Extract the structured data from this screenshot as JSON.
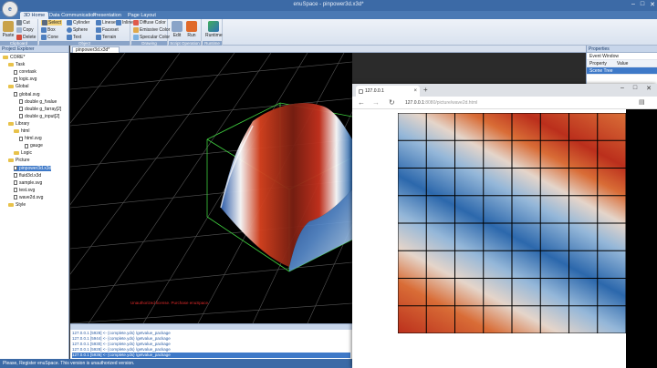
{
  "app": {
    "title": "enuSpace - pinpower3d.x3d*",
    "window_buttons": [
      "–",
      "□",
      "✕"
    ]
  },
  "ribbon": {
    "tabs": [
      "3D Home",
      "Data Communication",
      "Presentation",
      "Page Layout"
    ],
    "clipboard": {
      "paste": "Paste",
      "cut": "Cut",
      "copy": "Copy",
      "delete": "Delete",
      "group": "Clipboard"
    },
    "object": {
      "select": "Select",
      "box": "Box",
      "cone": "Cone",
      "cylinder": "Cylinder",
      "sphere": "Sphere",
      "text": "Text",
      "lineset": "Lineset",
      "faceset": "Faceset",
      "terrain": "Terrain",
      "inline": "Inline",
      "group": "Object"
    },
    "material": {
      "diffuse": "Diffuse Color",
      "emissive": "Emissive Color",
      "specular": "Specular Color",
      "group": "Drawing"
    },
    "script": {
      "edit": "Edit",
      "run": "Run",
      "group": "Script Operation"
    },
    "runtime": {
      "label": "Runtime",
      "group": "Runtime"
    }
  },
  "explorer": {
    "title": "Project Explorer",
    "items": [
      {
        "label": "CORE*",
        "level": 0,
        "kind": "folder"
      },
      {
        "label": "Task",
        "level": 1,
        "kind": "folder"
      },
      {
        "label": "coretask",
        "level": 2,
        "kind": "file"
      },
      {
        "label": "logic.svg",
        "level": 2,
        "kind": "file"
      },
      {
        "label": "Global",
        "level": 1,
        "kind": "folder"
      },
      {
        "label": "global.svg",
        "level": 2,
        "kind": "file"
      },
      {
        "label": "double g_fvalue",
        "level": 3,
        "kind": "file"
      },
      {
        "label": "double g_farray[2]",
        "level": 3,
        "kind": "file"
      },
      {
        "label": "double g_input[2]",
        "level": 3,
        "kind": "file"
      },
      {
        "label": "Library",
        "level": 1,
        "kind": "folder"
      },
      {
        "label": "html",
        "level": 2,
        "kind": "folder"
      },
      {
        "label": "html.svg",
        "level": 3,
        "kind": "file"
      },
      {
        "label": "gauge",
        "level": 4,
        "kind": "file"
      },
      {
        "label": "Logic",
        "level": 2,
        "kind": "folder"
      },
      {
        "label": "Picture",
        "level": 1,
        "kind": "folder"
      },
      {
        "label": "pinpower3d.x3d",
        "level": 2,
        "kind": "file",
        "selected": true
      },
      {
        "label": "fluid3d.x3d",
        "level": 2,
        "kind": "file"
      },
      {
        "label": "sample.svg",
        "level": 2,
        "kind": "file"
      },
      {
        "label": "test.svg",
        "level": 2,
        "kind": "file"
      },
      {
        "label": "wave2d.svg",
        "level": 2,
        "kind": "file"
      },
      {
        "label": "Style",
        "level": 1,
        "kind": "folder"
      }
    ]
  },
  "document": {
    "tab_label": "pinpower3d.x3d*",
    "watermark": "Unauthorized license. Purchase enuSpace."
  },
  "output": {
    "lines": [
      "127.0.0.1 [5928] <- {complete.yds} /getvalue_package",
      "127.0.0.1 [5944] <- {complete.yds} /getvalue_package",
      "127.0.0.1 [5930] <- {complete.yds} /getvalue_package",
      "127.0.0.1 [5928] <- {complete.yds} /getvalue_package",
      "127.0.0.1 [5936] <- {complete.yds} /getvalue_package"
    ],
    "selected_index": 4
  },
  "status": {
    "text": "Please, Register enuSpace. This version is unauthorized version."
  },
  "properties": {
    "title": "Properties",
    "dropdown": "Event Window",
    "col_property": "Property",
    "col_value": "Value",
    "section": "Scene Tree"
  },
  "browser": {
    "tab_title": "127.0.0.1",
    "new_tab": "+",
    "back": "←",
    "forward": "→",
    "reload": "↻",
    "url_host": "127.0.0.1",
    "url_path": ":8080/picture/wave2d.html",
    "window_buttons": [
      "–",
      "□",
      "✕"
    ]
  },
  "colors": {
    "titlebar": "#3c6aa6",
    "accent": "#3e79c8",
    "wave_red": "#c8321e",
    "wave_blue": "#2f6fb8",
    "grid_green": "#3fcf3f"
  }
}
